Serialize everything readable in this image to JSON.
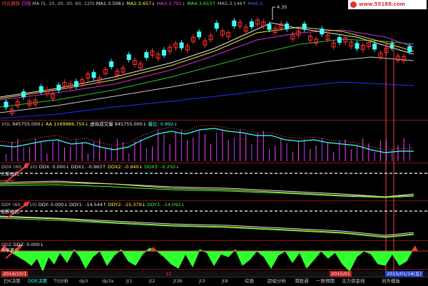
{
  "stock_name": "河北钢铁",
  "period": "日线",
  "ma_header": "MA (5, 10, 20, 30, 60, 120)",
  "ma_values": [
    {
      "label": "MA1:",
      "value": "3.506↓",
      "color": "#e8e8e8"
    },
    {
      "label": "MA2:",
      "value": "3.657↓",
      "color": "#ffff40"
    },
    {
      "label": "MA3:",
      "value": "3.701↓",
      "color": "#ff40ff"
    },
    {
      "label": "MA4:",
      "value": "3.653↑",
      "color": "#40ff40"
    },
    {
      "label": "MA5:",
      "value": "3.146↑",
      "color": "#c0c0c0"
    },
    {
      "label": "MA6:",
      "value": "2.",
      "color": "#4060ff"
    }
  ],
  "watermark": "www.55188.com",
  "price_high_label": "4.35",
  "vol": {
    "header": "VOL",
    "v1": "945755.000↓",
    "aa_label": "AA",
    "aa": "1169986.750↓",
    "tag": "虚拟成交量",
    "tag_value": "945755.000↓",
    "ratio_label": "量比:",
    "ratio_value": "0.892↓"
  },
  "ddx": {
    "header": "DDX (60, 5, 10)",
    "ddx": "DDX: 0.000↓",
    "ddx1": "DDX1: -0.963↑",
    "ddx2": "DDX2: -0.940↓",
    "ddx3": "DDX3: -0.250↓",
    "side_label": "大单动向"
  },
  "ddy": {
    "header": "DDY (60, 5, 10)",
    "ddy": "DDY: 0.000↓",
    "ddy1": "DDY1: -14.544↑",
    "ddy2": "DDY2: -15.379↓",
    "ddy3": "DDY3: -14.092↓",
    "side_label": "涨跌动因"
  },
  "ddz": {
    "header": "DDZ",
    "ddz": "DDZ: 0.000↓",
    "side_label": "大单差分"
  },
  "date_left": "2014/10/1",
  "date_mid": "12",
  "date_mid2": "2015/01",
  "date_cursor": "2015/01/16(五)",
  "tabs": [
    "日K决策",
    "DDE决策",
    "TS分析",
    "dp3",
    "dp3a",
    "jt1",
    "jt2",
    "jt3b",
    "jt3",
    "jt8",
    "综查",
    "超级分析",
    "港股通",
    "一致预期",
    "主力资金线",
    "另外模板"
  ],
  "active_tab": 1,
  "chart_data": {
    "type": "candlestick",
    "note": "Daily K-line with moving averages, volume, DDX, DDY, DDZ indicator panes",
    "price_high": 4.35,
    "ma_lines": [
      "MA1",
      "MA2",
      "MA3",
      "MA4",
      "MA5",
      "MA6"
    ]
  }
}
